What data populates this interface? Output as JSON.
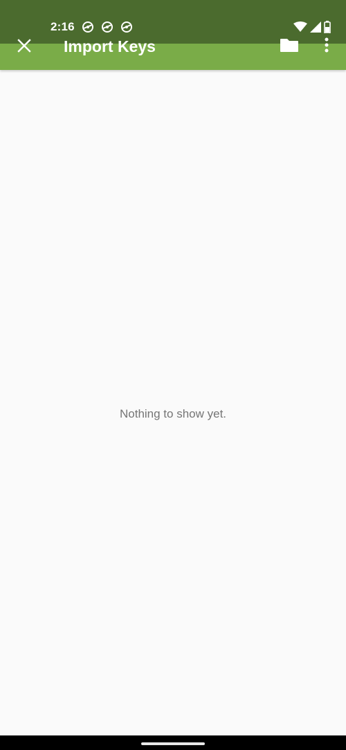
{
  "status_bar": {
    "time": "2:16",
    "notification_icons": [
      "vpn-key-icon",
      "vpn-key-icon",
      "vpn-key-icon"
    ],
    "system_icons": [
      "wifi-icon",
      "signal-icon",
      "battery-icon"
    ]
  },
  "app_bar": {
    "title": "Import Keys",
    "close_icon": "close-icon",
    "folder_icon": "folder-icon",
    "overflow_icon": "more-vert-icon"
  },
  "content": {
    "empty_message": "Nothing to show yet."
  },
  "colors": {
    "status_bar": "#4b6b2e",
    "app_bar": "#7aac48",
    "background": "#fafafa",
    "empty_text": "#757575"
  }
}
